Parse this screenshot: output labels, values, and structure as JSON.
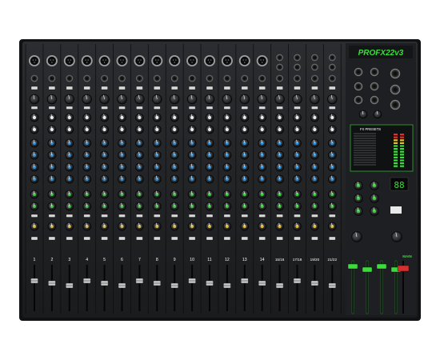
{
  "colors": {
    "chassis": "#1b1c1e",
    "panel": "#2a2c2f",
    "accent_green": "#3ddc3d",
    "knob_blue": "#2f8fd8",
    "knob_green": "#3cc43c",
    "knob_yellow": "#d9b23a",
    "knob_white": "#e8e8e8"
  },
  "brand": {
    "logo_text": "PROFX22v3"
  },
  "channel_numbers": [
    "1",
    "2",
    "3",
    "4",
    "5",
    "6",
    "7",
    "8",
    "9",
    "10",
    "11",
    "12",
    "13",
    "14",
    "15/16",
    "17/18",
    "19/20",
    "21/22"
  ],
  "fx": {
    "presets_label": "FX PRESETS",
    "display_value": "88"
  },
  "master": {
    "main_label": "MAIN"
  }
}
